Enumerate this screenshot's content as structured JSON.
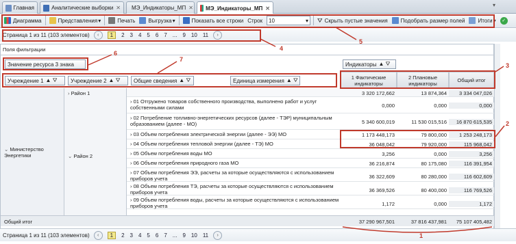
{
  "tabs": [
    {
      "label": "Главная",
      "active": false,
      "closable": false
    },
    {
      "label": "Аналитические выборки",
      "active": false,
      "closable": true
    },
    {
      "label": "МЭ_Индикаторы_МП",
      "active": false,
      "closable": true
    },
    {
      "label": "МЭ_Индикаторы_МП",
      "active": true,
      "closable": true
    }
  ],
  "toolbar": {
    "diagram": "Диаграмма",
    "views": "Представления",
    "print": "Печать",
    "export": "Выгрузка",
    "show_all_rows": "Показать все строки",
    "rows_label": "Строк",
    "rows_value": "10",
    "hide_empty": "Скрыть пустые значения",
    "fit_fields": "Подобрать размер полей",
    "totals": "Итоги"
  },
  "pager": {
    "info": "Страница 1 из 11 (103 элементов)",
    "pages": [
      "1",
      "2",
      "3",
      "4",
      "5",
      "6",
      "7",
      "...",
      "9",
      "10",
      "11"
    ],
    "current": "1"
  },
  "filter_area_label": "Поля фильтрации",
  "data_field": "Значение ресурса 3 знака",
  "indicators_header": "Индикаторы",
  "row_fields": [
    "Учреждение 1",
    "Учреждение 2",
    "Общие сведения",
    "Единица измерения"
  ],
  "col_headers": [
    "1 Фактические индикаторы",
    "2 Плановые индикаторы",
    "Общий итог"
  ],
  "group1": "Министерство Энергетики",
  "region1": "Район 1",
  "region2": "Район 2",
  "region1_values": [
    "3 320 172,662",
    "13 874,364",
    "3 334 047,026"
  ],
  "rows": [
    {
      "label": "01 Отгружено товаров собственного производства, выполнено работ и услуг собственными силами",
      "v": [
        "0,000",
        "0,000",
        "0,000"
      ]
    },
    {
      "label": "02 Потребление топливно-энергетических ресурсов (далее - ТЭР) муниципальным образованием (далее - МО)",
      "v": [
        "5 340 600,019",
        "11 530 015,516",
        "16 870 615,535"
      ]
    },
    {
      "label": "03 Объем потребления электрической энергии (далее - ЭЭ) МО",
      "v": [
        "1 173 448,173",
        "79 800,000",
        "1 253 248,173"
      ]
    },
    {
      "label": "04 Объем потребления тепловой энергии (далее - ТЭ) МО",
      "v": [
        "36 048,042",
        "79 920,000",
        "115 968,042"
      ]
    },
    {
      "label": "05 Объем потребления воды МО",
      "v": [
        "3,256",
        "0,000",
        "3,256"
      ]
    },
    {
      "label": "06 Объем потребления природного газа МО",
      "v": [
        "36 216,874",
        "80 175,080",
        "116 391,954"
      ]
    },
    {
      "label": "07 Объем потребления ЭЭ, расчеты за которые осуществляются с использованием приборов учета",
      "v": [
        "36 322,609",
        "80 280,000",
        "116 602,609"
      ]
    },
    {
      "label": "08 Объем потребления ТЭ, расчеты за которые осуществляются с использованием приборов учета",
      "v": [
        "36 369,526",
        "80 400,000",
        "116 769,526"
      ]
    },
    {
      "label": "09 Объем потребления воды, расчеты за которые осуществляются с использованием приборов учета",
      "v": [
        "1,172",
        "0,000",
        "1,172"
      ]
    }
  ],
  "grand_total_label": "Общий итог",
  "grand_total": [
    "37 290 967,501",
    "37 816 437,981",
    "75 107 405,482"
  ],
  "annotations": [
    "1",
    "2",
    "3",
    "4",
    "5",
    "6",
    "7"
  ],
  "colors": {
    "accent": "#c0392b",
    "current_page": "#f3e98c",
    "header": "#dde2e8"
  }
}
